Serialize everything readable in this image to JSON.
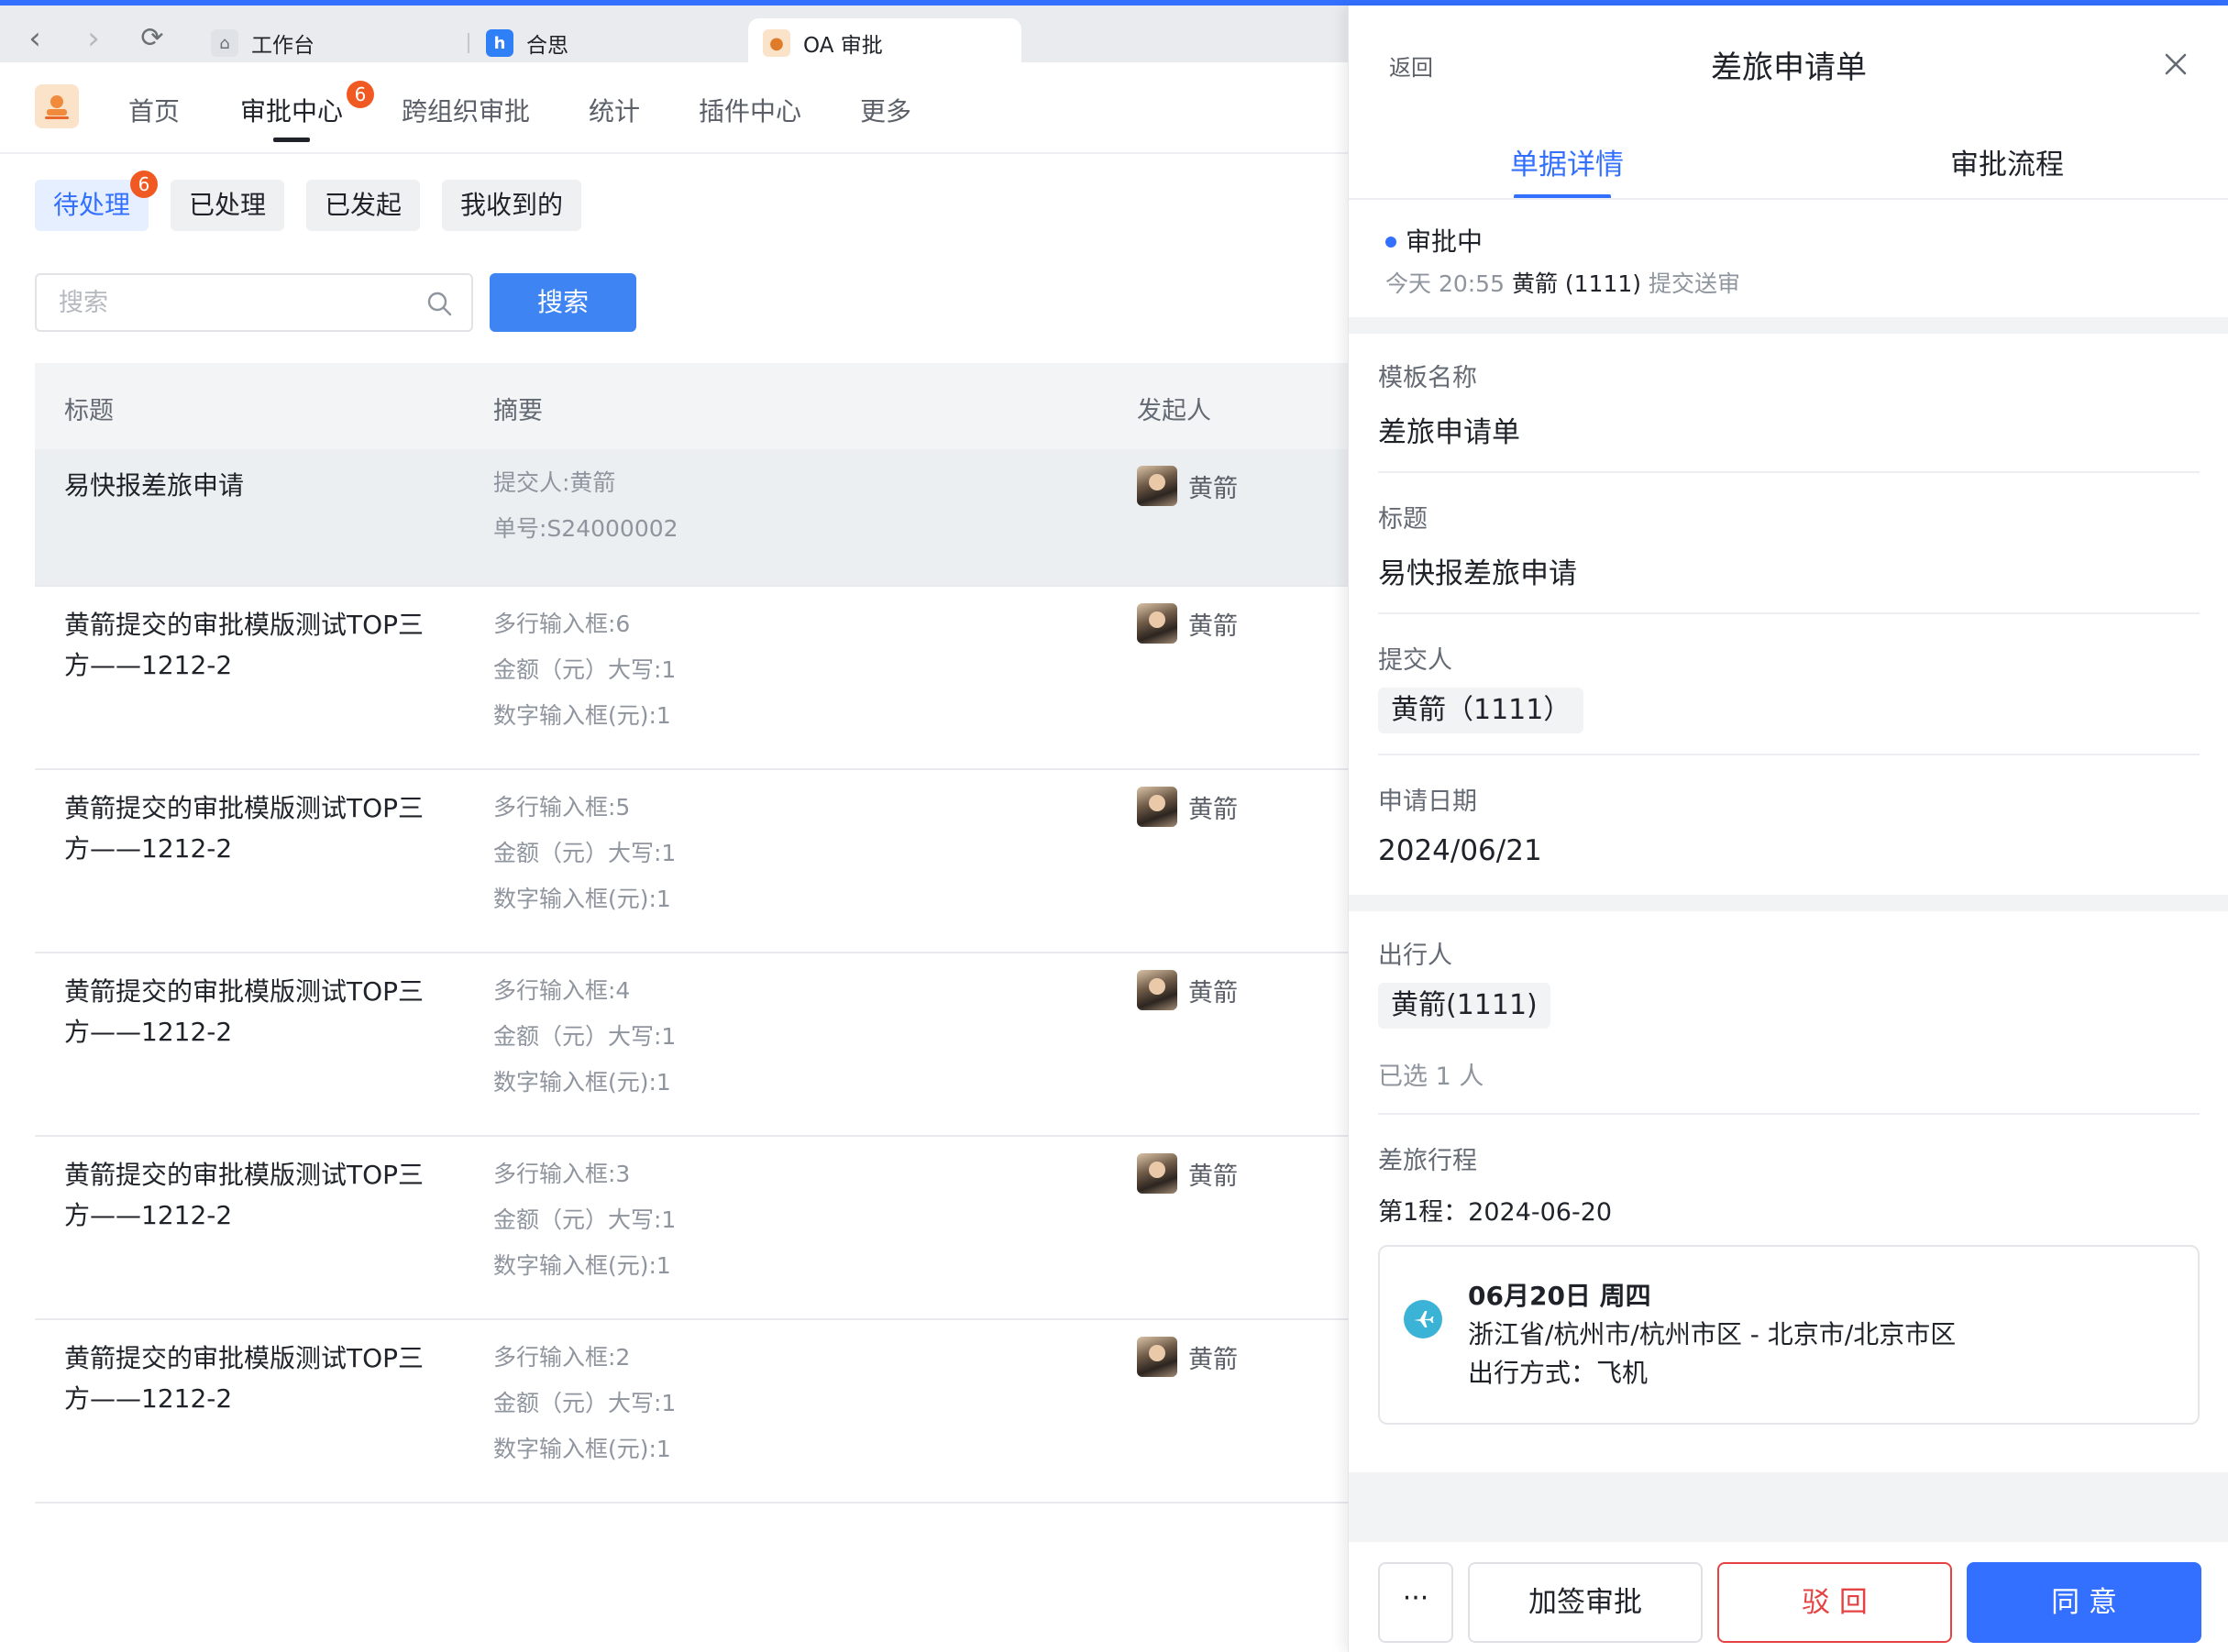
{
  "browser": {
    "tabs": [
      {
        "label": "工作台"
      },
      {
        "label": "合思"
      },
      {
        "label": "OA 审批"
      }
    ]
  },
  "app": {
    "menu": [
      {
        "label": "首页"
      },
      {
        "label": "审批中心",
        "badge": "6"
      },
      {
        "label": "跨组织审批"
      },
      {
        "label": "统计"
      },
      {
        "label": "插件中心"
      },
      {
        "label": "更多"
      }
    ],
    "filters": [
      {
        "label": "待处理",
        "badge": "6"
      },
      {
        "label": "已处理"
      },
      {
        "label": "已发起"
      },
      {
        "label": "我收到的"
      }
    ],
    "search": {
      "placeholder": "搜索",
      "button": "搜索"
    },
    "table": {
      "headers": [
        "标题",
        "摘要",
        "发起人"
      ],
      "rows": [
        {
          "title1": "易快报差旅申请",
          "title2": "",
          "summary": [
            "提交人:黄箭",
            "单号:S24000002",
            ""
          ],
          "initiator": "黄箭"
        },
        {
          "title1": "黄箭提交的审批模版测试TOP三",
          "title2": "方——1212-2",
          "summary": [
            "多行输入框:6",
            "金额（元）大写:1",
            "数字输入框(元):1"
          ],
          "initiator": "黄箭"
        },
        {
          "title1": "黄箭提交的审批模版测试TOP三",
          "title2": "方——1212-2",
          "summary": [
            "多行输入框:5",
            "金额（元）大写:1",
            "数字输入框(元):1"
          ],
          "initiator": "黄箭"
        },
        {
          "title1": "黄箭提交的审批模版测试TOP三",
          "title2": "方——1212-2",
          "summary": [
            "多行输入框:4",
            "金额（元）大写:1",
            "数字输入框(元):1"
          ],
          "initiator": "黄箭"
        },
        {
          "title1": "黄箭提交的审批模版测试TOP三",
          "title2": "方——1212-2",
          "summary": [
            "多行输入框:3",
            "金额（元）大写:1",
            "数字输入框(元):1"
          ],
          "initiator": "黄箭"
        },
        {
          "title1": "黄箭提交的审批模版测试TOP三",
          "title2": "方——1212-2",
          "summary": [
            "多行输入框:2",
            "金额（元）大写:1",
            "数字输入框(元):1"
          ],
          "initiator": "黄箭"
        }
      ]
    }
  },
  "panel": {
    "back": "返回",
    "title": "差旅申请单",
    "tabs": [
      "单据详情",
      "审批流程"
    ],
    "status": {
      "label": "审批中",
      "time": "今天 20:55",
      "user": "黄箭 (1111)",
      "action": "提交送审"
    },
    "fields": {
      "template_label": "模板名称",
      "template_value": "差旅申请单",
      "title_label": "标题",
      "title_value": "易快报差旅申请",
      "submitter_label": "提交人",
      "submitter_value": "黄箭（1111）",
      "date_label": "申请日期",
      "date_value": "2024/06/21",
      "traveler_label": "出行人",
      "traveler_value": "黄箭(1111)",
      "traveler_count": "已选 1 人",
      "itinerary_label": "差旅行程",
      "leg_label": "第1程：2024-06-20"
    },
    "trip": {
      "date": "06月20日 周四",
      "route": "浙江省/杭州市/杭州市区 - 北京市/北京市区",
      "mode": "出行方式：飞机"
    },
    "footer": {
      "more": "···",
      "add_sign": "加签审批",
      "reject": "驳 回",
      "agree": "同 意"
    }
  },
  "colors": {
    "accent": "#3370ff",
    "badge": "#f05a22",
    "reject": "#e54343"
  }
}
